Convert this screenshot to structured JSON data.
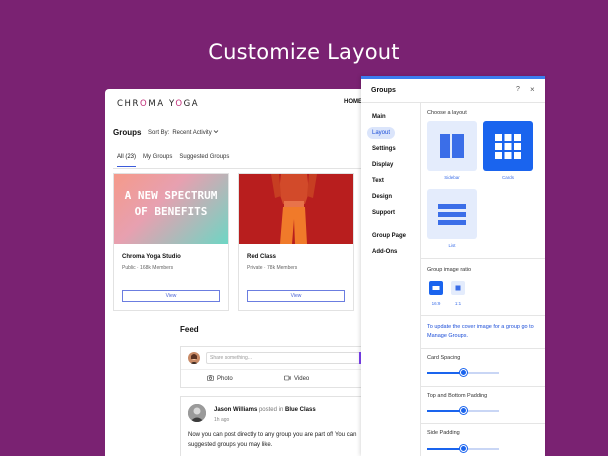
{
  "headline": "Customize Layout",
  "site": {
    "logo": "CHR",
    "logo_o": "O",
    "logo_rest": "MA Y",
    "logo_o2": "O",
    "logo_end": "GA",
    "nav_home": "HOME",
    "groups_title": "Groups",
    "sort_label": "Sort By:",
    "sort_value": "Recent Activity",
    "tabs": [
      {
        "label": "All (23)",
        "active": true
      },
      {
        "label": "My Groups",
        "active": false
      },
      {
        "label": "Suggested Groups",
        "active": false
      }
    ],
    "cards": [
      {
        "banner_line1": "A NEW SPECTRUM",
        "banner_line2": "OF BENEFITS",
        "name": "Chroma Yoga Studio",
        "meta": "Public · 168k Members",
        "button": "View"
      },
      {
        "name": "Red Class",
        "meta": "Private · 78k Members",
        "button": "View"
      }
    ],
    "feed": {
      "title": "Feed",
      "share_placeholder": "Share something...",
      "photo_label": "Photo",
      "video_label": "Video",
      "post": {
        "author": "Jason Williams",
        "posted_in": "posted in",
        "group": "Blue Class",
        "time": "1h ago",
        "line1": "Now you can post directly to any group you are part of! You can",
        "line2": "suggested groups you may like."
      }
    }
  },
  "panel": {
    "title": "Groups",
    "help": "?",
    "close": "×",
    "nav": [
      {
        "label": "Main",
        "active": false
      },
      {
        "label": "Layout",
        "active": true
      },
      {
        "label": "Settings",
        "active": false
      },
      {
        "label": "Display",
        "active": false
      },
      {
        "label": "Text",
        "active": false
      },
      {
        "label": "Design",
        "active": false
      },
      {
        "label": "Support",
        "active": false
      },
      {
        "label": "Group Page",
        "active": false
      },
      {
        "label": "Add-Ons",
        "active": false
      }
    ],
    "choose_layout": "Choose a layout",
    "layouts": [
      {
        "label": "Sidebar",
        "selected": false
      },
      {
        "label": "Cards",
        "selected": true
      },
      {
        "label": "List",
        "selected": false
      }
    ],
    "ratio_label": "Group image ratio",
    "ratios": [
      {
        "label": "16:9",
        "selected": true
      },
      {
        "label": "1:1",
        "selected": false
      }
    ],
    "note_text": "To update the cover image for a group go to",
    "note_link": "Manage Groups.",
    "sliders": [
      {
        "label": "Card Spacing",
        "value": "20",
        "unit": "px",
        "fraction": 0.5
      },
      {
        "label": "Top and Bottom Padding",
        "value": "40",
        "unit": "px",
        "fraction": 0.5
      },
      {
        "label": "Side Padding",
        "value": "40",
        "unit": "px",
        "fraction": 0.5
      }
    ]
  },
  "colors": {
    "background": "#7a2272",
    "accent": "#1a64ee",
    "logo_accent": "#c1307a"
  }
}
